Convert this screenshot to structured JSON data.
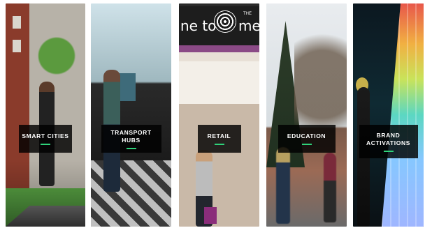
{
  "tiles": [
    {
      "id": "smart-cities",
      "label": "SMART CITIES"
    },
    {
      "id": "transport-hubs",
      "label": "TRANSPORT HUBS"
    },
    {
      "id": "retail",
      "label": "RETAIL",
      "sign_text": "ne to",
      "sign_text_2": "me",
      "sign_small": "THE"
    },
    {
      "id": "education",
      "label": "EDUCATION"
    },
    {
      "id": "brand-activations",
      "label_line1": "BRAND",
      "label_line2": "ACTIVATIONS"
    }
  ],
  "colors": {
    "label_bg": "#000000",
    "accent_bar": "#2fd27a"
  }
}
